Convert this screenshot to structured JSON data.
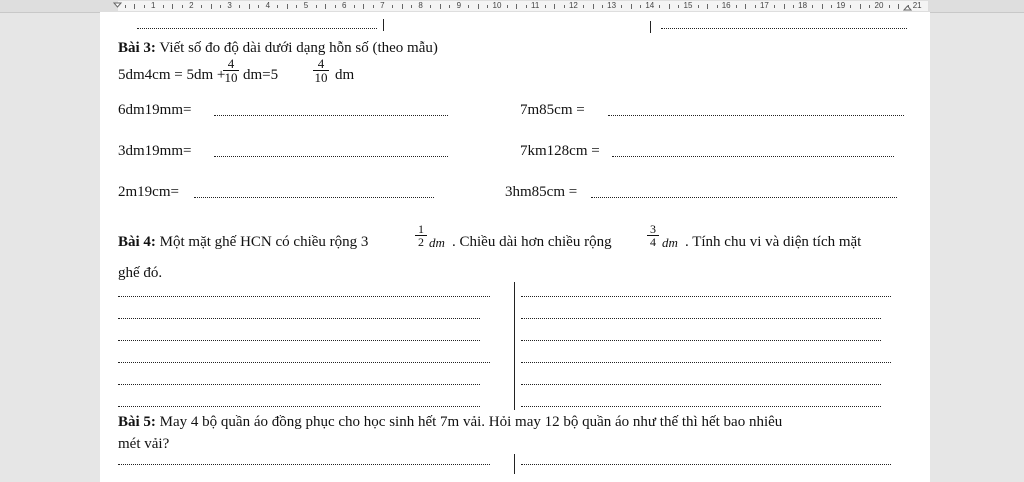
{
  "ruler": {
    "numbers": [
      "1",
      "2",
      "3",
      "4",
      "5",
      "6",
      "7",
      "8",
      "9",
      "10",
      "11",
      "12",
      "13",
      "14",
      "15",
      "16",
      "17",
      "18",
      "19",
      "20",
      "21"
    ]
  },
  "bai3": {
    "label": "Bài 3:",
    "title": " Viết số đo độ dài dưới dạng hỗn số (theo mẫu)",
    "example": {
      "left": "5dm4cm = 5dm + ",
      "frac1_num": "4",
      "frac1_den": "10",
      "mid": "dm=5",
      "frac2_num": "4",
      "frac2_den": "10",
      "unit": "dm"
    },
    "items": [
      "6dm19mm=",
      "7m85cm =",
      "3dm19mm=",
      "7km128cm =",
      "2m19cm=",
      "3hm85cm ="
    ]
  },
  "bai4": {
    "label": "Bài 4:",
    "text1": " Một mặt ghế HCN có chiều rộng 3",
    "frac1_num": "1",
    "frac1_den": "2",
    "unit1": "dm",
    "text2": ". Chiều dài hơn chiều rộng ",
    "frac2_num": "3",
    "frac2_den": "4",
    "unit2": "dm",
    "text3": ". Tính chu vi và diện tích mặt",
    "line2": "ghế đó."
  },
  "bai5": {
    "label": "Bài 5:",
    "text1": " May 4 bộ quần áo đồng phục cho học sinh hết 7m vải. Hỏi may 12 bộ quần áo như thế thì hết bao nhiêu",
    "line2": "mét vải?"
  }
}
